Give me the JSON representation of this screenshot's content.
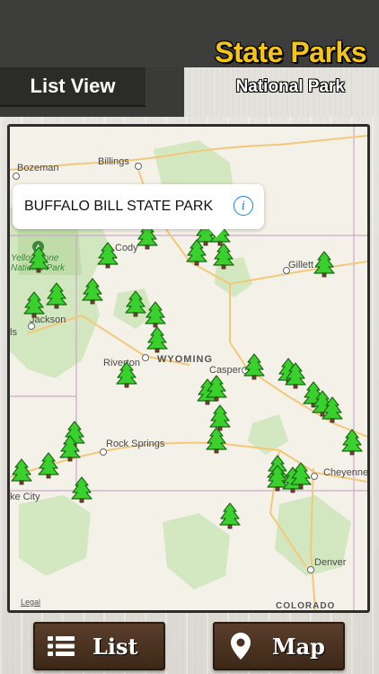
{
  "header": {
    "list_view_label": "List View",
    "app_title": "State Parks",
    "app_subtitle": "National Park"
  },
  "map": {
    "state_label": "WYOMING",
    "park_label_line1": "Yellowstone",
    "park_label_line2": "National Park",
    "legal_label": "Legal",
    "places": {
      "bozeman": "Bozeman",
      "billings": "Billings",
      "cody": "Cody",
      "gillette": "Gillett",
      "jackson": "Jackson",
      "riverton": "Riverton",
      "casper": "Casper",
      "rock_springs": "Rock Springs",
      "cheyenne": "Cheyenne",
      "salt_lake_city": "ke City",
      "denver": "Denver",
      "colorado": "COLORADO",
      "partial_ls": "ls"
    },
    "callout": {
      "title": "BUFFALO BILL STATE PARK",
      "info_icon": "info-circle-icon"
    },
    "marker_icon": "pine-tree-icon",
    "marker_color": "#3ad12e"
  },
  "buttons": {
    "list_label": "List",
    "list_icon": "list-icon",
    "map_label": "Map",
    "map_icon": "map-pin-icon"
  },
  "colors": {
    "title_yellow": "#f5c518",
    "button_brown": "#4a3221",
    "header_dark": "#3a3a38"
  }
}
